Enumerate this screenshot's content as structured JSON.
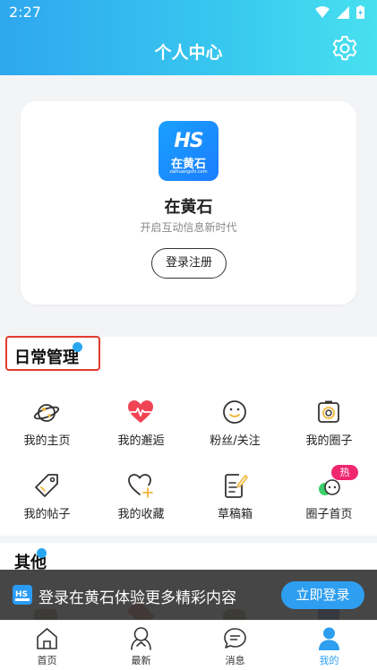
{
  "status_bar": {
    "time": "2:27"
  },
  "header": {
    "title": "个人中心",
    "settings_icon": "gear-icon"
  },
  "profile": {
    "logo": {
      "mark": "HS",
      "name": "在黄石",
      "domain": "zaihuangshi.com"
    },
    "name": "在黄石",
    "slogan": "开启互动信息新时代",
    "login_button": "登录注册"
  },
  "daily": {
    "title": "日常管理",
    "items": [
      {
        "label": "我的主页",
        "icon": "planet-icon"
      },
      {
        "label": "我的邂逅",
        "icon": "heartbeat-icon"
      },
      {
        "label": "粉丝/关注",
        "icon": "smile-icon"
      },
      {
        "label": "我的圈子",
        "icon": "camera-icon"
      },
      {
        "label": "我的帖子",
        "icon": "tag-icon"
      },
      {
        "label": "我的收藏",
        "icon": "heart-plus-icon"
      },
      {
        "label": "草稿箱",
        "icon": "draft-icon"
      },
      {
        "label": "圈子首页",
        "icon": "circle-home-icon",
        "badge": "热"
      }
    ]
  },
  "others": {
    "title": "其他"
  },
  "banner": {
    "text": "登录在黄石体验更多精彩内容",
    "button": "立即登录"
  },
  "tabbar": {
    "tabs": [
      {
        "label": "首页",
        "icon": "home-icon"
      },
      {
        "label": "最新",
        "icon": "latest-icon"
      },
      {
        "label": "消息",
        "icon": "message-icon"
      },
      {
        "label": "我的",
        "icon": "user-icon",
        "active": true
      }
    ]
  },
  "colors": {
    "accent": "#2e9ef0",
    "highlight": "#e23b2f",
    "hot": "#f0266e",
    "heart": "#f04455"
  }
}
